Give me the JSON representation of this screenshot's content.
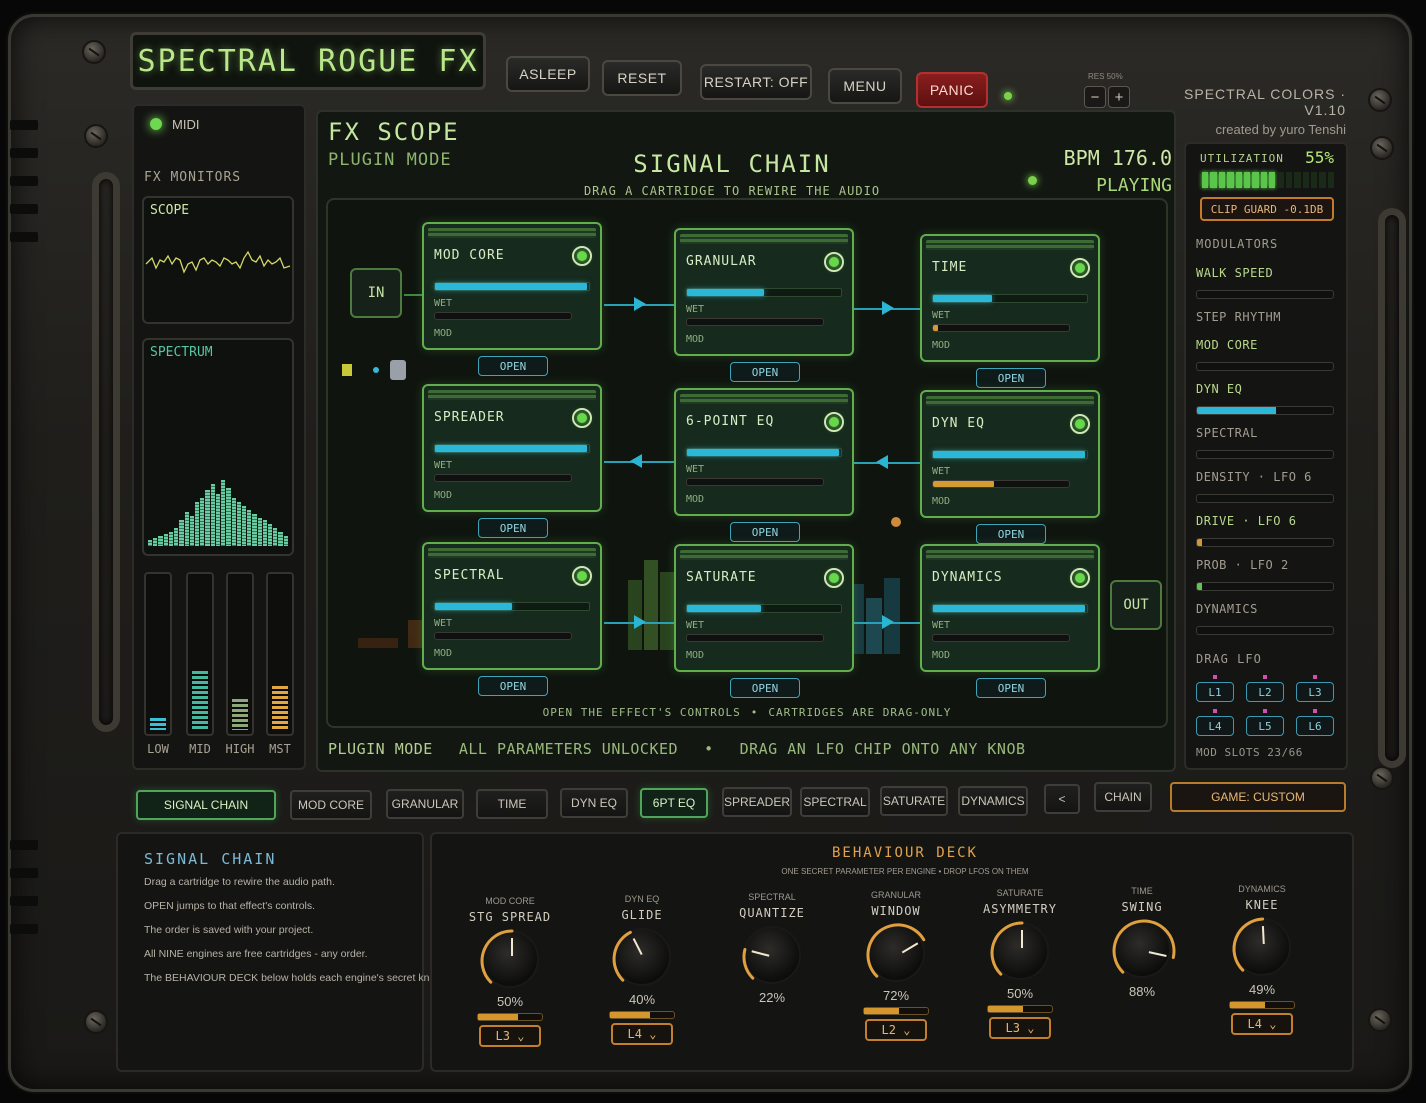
{
  "app": {
    "title": "SPECTRAL ROGUE FX",
    "brand_version": "SPECTRAL COLORS · V1.10",
    "brand_credit": "created by yuro Tenshi"
  },
  "toolbar": {
    "asleep": "ASLEEP",
    "reset": "RESET",
    "restart": "RESTART: OFF",
    "menu": "MENU",
    "panic": "PANIC",
    "res_label": "RES 50%",
    "res_minus": "−",
    "res_plus": "+"
  },
  "left": {
    "midi": "MIDI",
    "fx_monitors": "FX MONITORS",
    "scope": "SCOPE",
    "spectrum": "SPECTRUM",
    "meters": [
      {
        "label": "LOW",
        "level": 0.08,
        "color": "#3ac0d4"
      },
      {
        "label": "MID",
        "level": 0.38,
        "color": "#46b8a0"
      },
      {
        "label": "HIGH",
        "level": 0.2,
        "color": "#8aa878"
      },
      {
        "label": "MST",
        "level": 0.28,
        "color": "#e0a640"
      }
    ]
  },
  "main": {
    "fx_scope": "FX SCOPE",
    "plugin_mode": "PLUGIN MODE",
    "signal_chain_title": "SIGNAL CHAIN",
    "signal_chain_sub": "DRAG A CARTRIDGE TO REWIRE THE AUDIO",
    "bpm": "BPM 176.0",
    "playing": "PLAYING",
    "in_label": "IN",
    "out_label": "OUT",
    "wet_label": "WET",
    "mod_label": "MOD",
    "open_label": "OPEN",
    "cartridges": [
      {
        "name": "MOD CORE",
        "wet": 0.99,
        "mod": 0
      },
      {
        "name": "GRANULAR",
        "wet": 0.5,
        "mod": 0
      },
      {
        "name": "TIME",
        "wet": 0.38,
        "mod": 0.04
      },
      {
        "name": "SPREADER",
        "wet": 0.99,
        "mod": 0
      },
      {
        "name": "6-POINT EQ",
        "wet": 0.99,
        "mod": 0
      },
      {
        "name": "DYN EQ",
        "wet": 0.99,
        "mod": 0.45
      },
      {
        "name": "SPECTRAL",
        "wet": 0.5,
        "mod": 0
      },
      {
        "name": "SATURATE",
        "wet": 0.48,
        "mod": 0
      },
      {
        "name": "DYNAMICS",
        "wet": 0.99,
        "mod": 0
      }
    ],
    "hint_open": "OPEN  THE EFFECT'S CONTROLS",
    "hint_drag": "CARTRIDGES ARE DRAG-ONLY",
    "status_mode": "PLUGIN MODE",
    "status_unlocked": "ALL PARAMETERS UNLOCKED",
    "status_drag": "DRAG AN LFO CHIP ONTO ANY KNOB"
  },
  "right": {
    "utilization_label": "UTILIZATION",
    "utilization_value": "55%",
    "utilization_level": 0.55,
    "clip_guard": "CLIP GUARD -0.1DB",
    "modulators_title": "MODULATORS",
    "modulators": [
      {
        "label": "WALK SPEED",
        "level": 0,
        "highlight": true
      },
      {
        "label": "STEP RHYTHM",
        "level": null,
        "highlight": false
      },
      {
        "label": "MOD CORE",
        "level": 0,
        "highlight": true
      },
      {
        "label": "DYN EQ",
        "level": 0.58,
        "highlight": true
      },
      {
        "label": "SPECTRAL",
        "level": 0,
        "highlight": false
      },
      {
        "label": "DENSITY · LFO 6",
        "level": 0,
        "highlight": false
      },
      {
        "label": "DRIVE · LFO 6",
        "level": 0.04,
        "highlight": true
      },
      {
        "label": "PROB · LFO 2",
        "level": 0.04,
        "highlight": false
      },
      {
        "label": "DYNAMICS",
        "level": 0,
        "highlight": false
      }
    ],
    "drag_lfo": "DRAG LFO",
    "lfos": [
      "L1",
      "L2",
      "L3",
      "L4",
      "L5",
      "L6"
    ],
    "mod_slots": "MOD SLOTS 23/66"
  },
  "tabs": {
    "items": [
      "SIGNAL CHAIN",
      "MOD CORE",
      "GRANULAR",
      "TIME",
      "DYN EQ",
      "6PT EQ",
      "SPREADER",
      "SPECTRAL",
      "SATURATE",
      "DYNAMICS"
    ],
    "prev": "<",
    "chain": "CHAIN",
    "game": "GAME: CUSTOM"
  },
  "info": {
    "title": "SIGNAL CHAIN",
    "lines": [
      "Drag a cartridge to rewire the audio path.",
      "OPEN jumps to that effect's controls.",
      "The order is saved with your project.",
      "All NINE engines are free cartridges - any order.",
      "The BEHAVIOUR DECK below holds each engine's secret knob."
    ]
  },
  "deck": {
    "title": "BEHAVIOUR DECK",
    "sub": "ONE SECRET PARAMETER PER ENGINE  •  DROP LFOS ON THEM",
    "knobs": [
      {
        "engine": "MOD CORE",
        "param": "STG SPREAD",
        "value": "50%",
        "level": 0.5,
        "amount": 0.62,
        "lfo": "L3 ⌄"
      },
      {
        "engine": "DYN EQ",
        "param": "GLIDE",
        "value": "40%",
        "level": 0.4,
        "amount": 0.62,
        "lfo": "L4 ⌄"
      },
      {
        "engine": "SPECTRAL",
        "param": "QUANTIZE",
        "value": "22%",
        "level": 0.22,
        "amount": null,
        "lfo": null
      },
      {
        "engine": "GRANULAR",
        "param": "WINDOW",
        "value": "72%",
        "level": 0.72,
        "amount": 0.55,
        "lfo": "L2 ⌄"
      },
      {
        "engine": "SATURATE",
        "param": "ASYMMETRY",
        "value": "50%",
        "level": 0.5,
        "amount": 0.55,
        "lfo": "L3 ⌄"
      },
      {
        "engine": "TIME",
        "param": "SWING",
        "value": "88%",
        "level": 0.88,
        "amount": null,
        "lfo": null
      },
      {
        "engine": "DYNAMICS",
        "param": "KNEE",
        "value": "49%",
        "level": 0.49,
        "amount": 0.55,
        "lfo": "L4 ⌄"
      }
    ]
  },
  "colors": {
    "accent_green": "#66d84a",
    "accent_cyan": "#2bb8d8",
    "accent_orange": "#d6962e",
    "panic_red": "#8a1e1e"
  }
}
